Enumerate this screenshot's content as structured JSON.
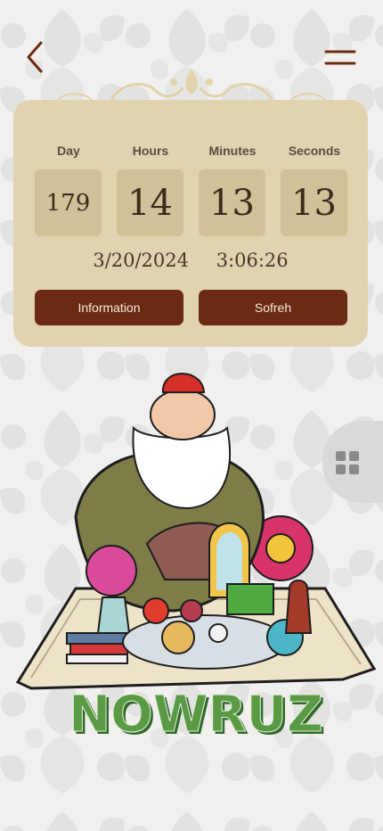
{
  "header": {
    "back_icon": "chevron-left-icon",
    "menu_icon": "hamburger-menu-icon"
  },
  "countdown": {
    "labels": {
      "day": "Day",
      "hours": "Hours",
      "minutes": "Minutes",
      "seconds": "Seconds"
    },
    "values": {
      "day": "179",
      "hours": "14",
      "minutes": "13",
      "seconds": "13"
    },
    "target_date": "3/20/2024",
    "target_time": "3:06:26"
  },
  "actions": {
    "information_label": "Information",
    "sofreh_label": "Sofreh"
  },
  "side_tab": {
    "icon": "grid-icon"
  },
  "illustration": {
    "title": "NOWRUZ"
  },
  "colors": {
    "card_bg": "#e1d3af",
    "box_bg": "#d1c198",
    "button_bg": "#6b2b13",
    "title_green": "#4e8a3d"
  }
}
